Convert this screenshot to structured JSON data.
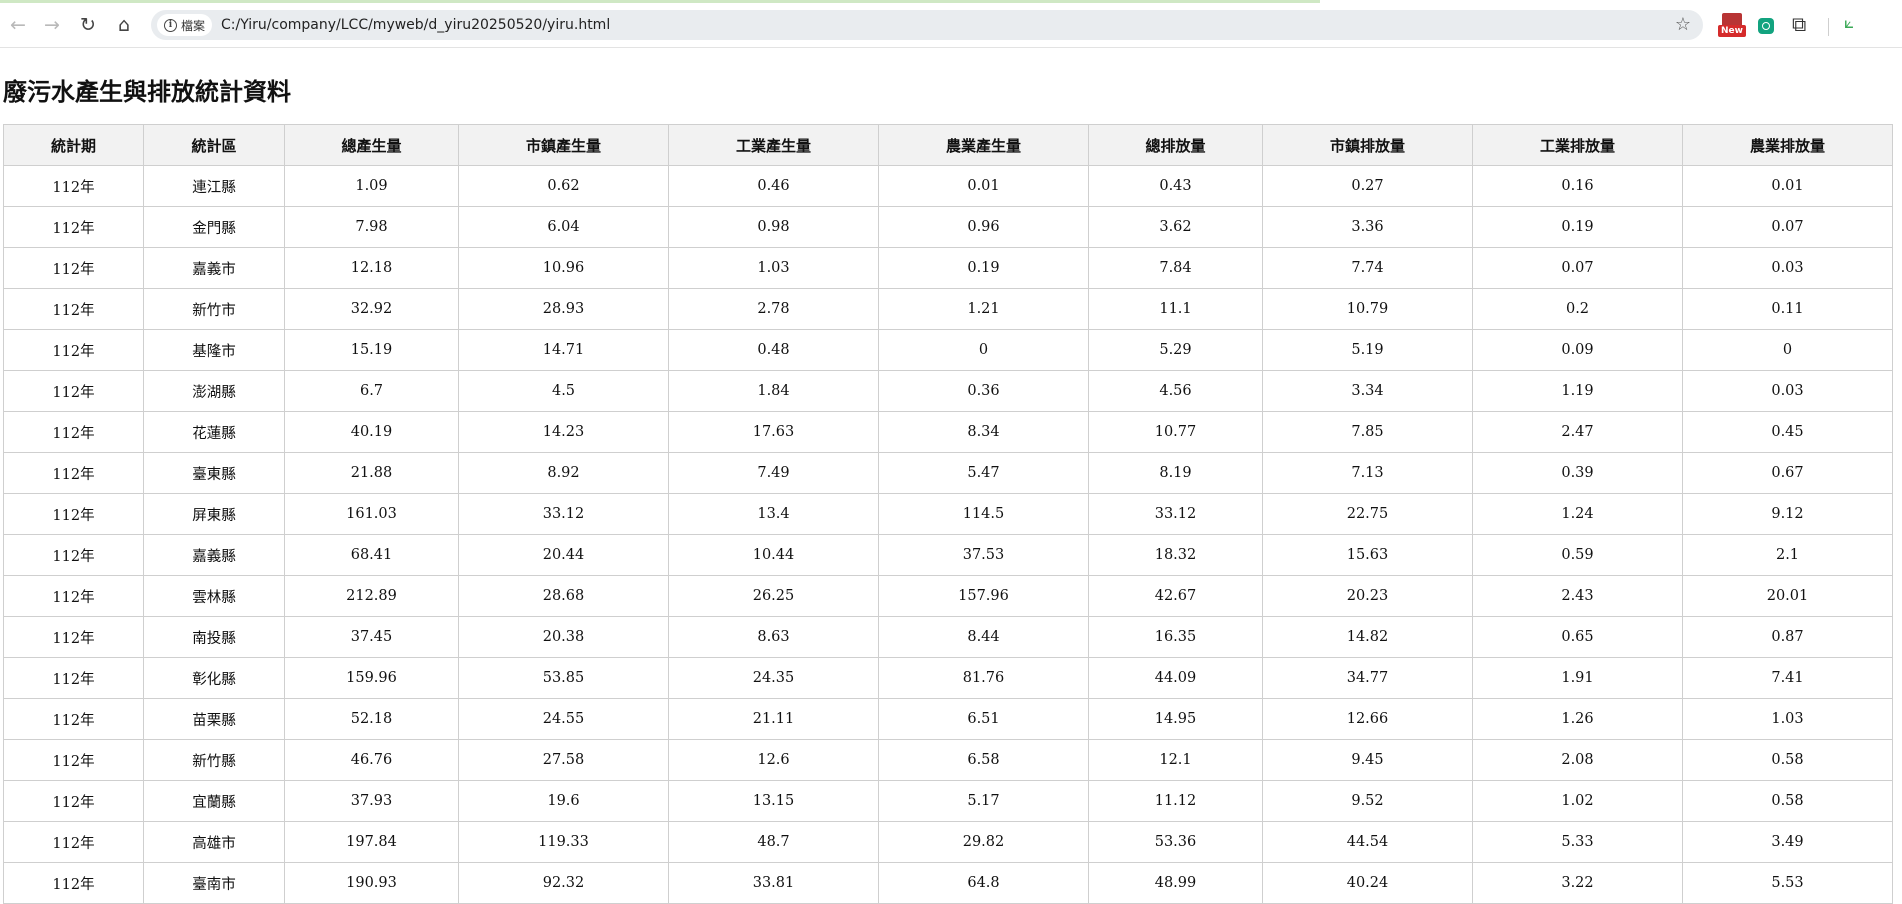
{
  "browser": {
    "chip_label": "檔案",
    "url": "C:/Yiru/company/LCC/myweb/d_yiru20250520/yiru.html",
    "ext_new_label": "New"
  },
  "page": {
    "title": "廢污水產生與排放統計資料"
  },
  "table": {
    "headers": [
      "統計期",
      "統計區",
      "總產生量",
      "市鎮產生量",
      "工業產生量",
      "農業產生量",
      "總排放量",
      "市鎮排放量",
      "工業排放量",
      "農業排放量"
    ],
    "rows": [
      [
        "112年",
        "連江縣",
        "1.09",
        "0.62",
        "0.46",
        "0.01",
        "0.43",
        "0.27",
        "0.16",
        "0.01"
      ],
      [
        "112年",
        "金門縣",
        "7.98",
        "6.04",
        "0.98",
        "0.96",
        "3.62",
        "3.36",
        "0.19",
        "0.07"
      ],
      [
        "112年",
        "嘉義市",
        "12.18",
        "10.96",
        "1.03",
        "0.19",
        "7.84",
        "7.74",
        "0.07",
        "0.03"
      ],
      [
        "112年",
        "新竹市",
        "32.92",
        "28.93",
        "2.78",
        "1.21",
        "11.1",
        "10.79",
        "0.2",
        "0.11"
      ],
      [
        "112年",
        "基隆市",
        "15.19",
        "14.71",
        "0.48",
        "0",
        "5.29",
        "5.19",
        "0.09",
        "0"
      ],
      [
        "112年",
        "澎湖縣",
        "6.7",
        "4.5",
        "1.84",
        "0.36",
        "4.56",
        "3.34",
        "1.19",
        "0.03"
      ],
      [
        "112年",
        "花蓮縣",
        "40.19",
        "14.23",
        "17.63",
        "8.34",
        "10.77",
        "7.85",
        "2.47",
        "0.45"
      ],
      [
        "112年",
        "臺東縣",
        "21.88",
        "8.92",
        "7.49",
        "5.47",
        "8.19",
        "7.13",
        "0.39",
        "0.67"
      ],
      [
        "112年",
        "屏東縣",
        "161.03",
        "33.12",
        "13.4",
        "114.5",
        "33.12",
        "22.75",
        "1.24",
        "9.12"
      ],
      [
        "112年",
        "嘉義縣",
        "68.41",
        "20.44",
        "10.44",
        "37.53",
        "18.32",
        "15.63",
        "0.59",
        "2.1"
      ],
      [
        "112年",
        "雲林縣",
        "212.89",
        "28.68",
        "26.25",
        "157.96",
        "42.67",
        "20.23",
        "2.43",
        "20.01"
      ],
      [
        "112年",
        "南投縣",
        "37.45",
        "20.38",
        "8.63",
        "8.44",
        "16.35",
        "14.82",
        "0.65",
        "0.87"
      ],
      [
        "112年",
        "彰化縣",
        "159.96",
        "53.85",
        "24.35",
        "81.76",
        "44.09",
        "34.77",
        "1.91",
        "7.41"
      ],
      [
        "112年",
        "苗栗縣",
        "52.18",
        "24.55",
        "21.11",
        "6.51",
        "14.95",
        "12.66",
        "1.26",
        "1.03"
      ],
      [
        "112年",
        "新竹縣",
        "46.76",
        "27.58",
        "12.6",
        "6.58",
        "12.1",
        "9.45",
        "2.08",
        "0.58"
      ],
      [
        "112年",
        "宜蘭縣",
        "37.93",
        "19.6",
        "13.15",
        "5.17",
        "11.12",
        "9.52",
        "1.02",
        "0.58"
      ],
      [
        "112年",
        "高雄市",
        "197.84",
        "119.33",
        "48.7",
        "29.82",
        "53.36",
        "44.54",
        "5.33",
        "3.49"
      ],
      [
        "112年",
        "臺南市",
        "190.93",
        "92.32",
        "33.81",
        "64.8",
        "48.99",
        "40.24",
        "3.22",
        "5.53"
      ]
    ]
  }
}
